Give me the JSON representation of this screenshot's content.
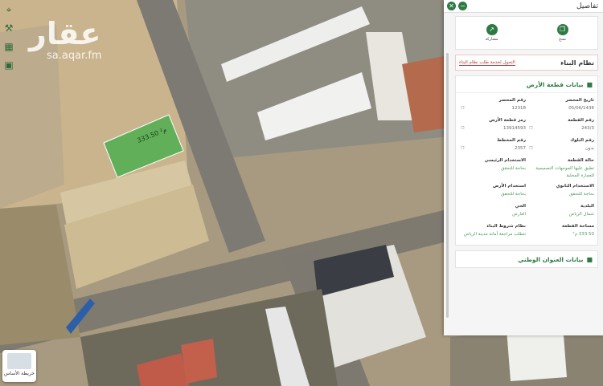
{
  "watermark": {
    "brand": "عقار",
    "domain": "sa.aqar.fm"
  },
  "map": {
    "plot_label": "333.50 م²",
    "map_type_label": "خريطة الأساس"
  },
  "panel": {
    "title": "تفاصيل",
    "actions": [
      {
        "label": "مشاركة",
        "icon": "share-icon"
      },
      {
        "label": "نسخ",
        "icon": "copy-icon"
      }
    ],
    "building_system": {
      "title": "نظام البناء",
      "link": "التحول لخدمة طلب نظام البناء"
    },
    "land_section": {
      "title": "بيانات قطعة الأرض",
      "fields": [
        {
          "label": "تاريخ المحضر",
          "value": "05/06/1436"
        },
        {
          "label": "رقم المحضر",
          "value": "12318"
        },
        {
          "label": "رقم القطعة",
          "value": "243/3"
        },
        {
          "label": "رمز قطعة الأرض",
          "value": "13914593"
        },
        {
          "label": "رقم البلوك",
          "value": "بدون"
        },
        {
          "label": "رقم المخطط",
          "value": "2357"
        },
        {
          "label": "حالة القطعة",
          "value": "تطبق عليها الموجهات التصميمية للعمارة المحلية"
        },
        {
          "label": "الاستخدام الرئيسي",
          "value": "بحاجة للتحقق"
        },
        {
          "label": "الاستخدام الثانوي",
          "value": "بحاجة للتحقق"
        },
        {
          "label": "استخدام الأرض",
          "value": "بحاجة للتحقق"
        },
        {
          "label": "البلدية",
          "value": "شمال الرياض"
        },
        {
          "label": "الحي",
          "value": "العارض"
        },
        {
          "label": "مساحة القطعة",
          "value": "333.50 م²"
        },
        {
          "label": "نظام شروط البناء",
          "value": "تتطلب مراجعة أمانة مدينة الرياض"
        }
      ]
    },
    "national_address": {
      "title": "بيانات العنوان الوطني"
    }
  },
  "colors": {
    "accent": "#2d7a43",
    "plot_fill": "#3fae48"
  }
}
